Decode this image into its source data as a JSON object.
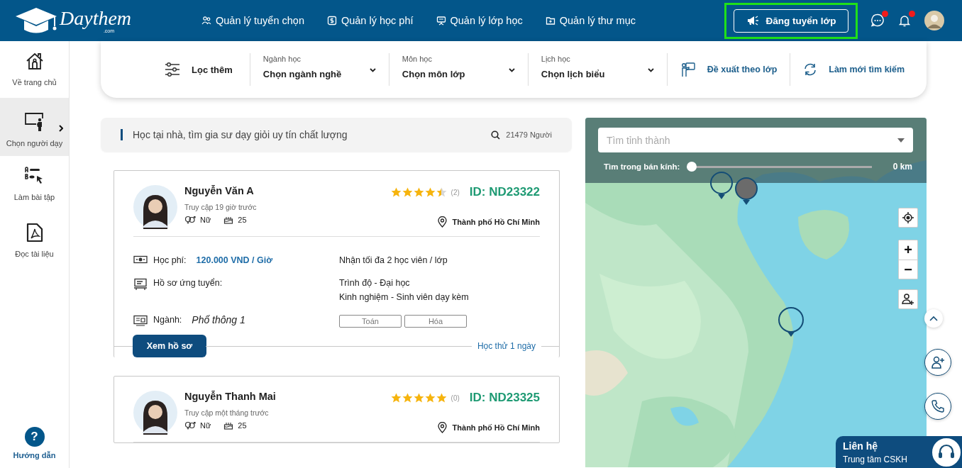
{
  "header": {
    "logo": "Daythem",
    "logo_sub": ".com",
    "nav": [
      "Quản lý tuyển chọn",
      "Quản lý học phí",
      "Quản lý lớp học",
      "Quản lý thư mục"
    ],
    "post_button": "Đăng tuyển lớp",
    "chat_unread": true,
    "bell_unread": true
  },
  "sidebar": {
    "items": [
      {
        "label": "Về trang chủ",
        "selected": false
      },
      {
        "label": "Chọn người dạy",
        "selected": true
      },
      {
        "label": "Làm bài tập",
        "selected": false
      },
      {
        "label": "Đọc tài liệu",
        "selected": false
      }
    ],
    "help": {
      "symbol": "?",
      "label": "Hướng dẫn"
    }
  },
  "filter_bar": {
    "filter_button": "Lọc thêm",
    "selects": [
      {
        "label": "Ngành học",
        "value": "Chọn ngành nghề"
      },
      {
        "label": "Môn học",
        "value": "Chọn môn lớp"
      },
      {
        "label": "Lịch học",
        "value": "Chọn lịch biểu"
      }
    ],
    "actions": [
      "Đề xuất theo lớp",
      "Làm mới tìm kiếm"
    ]
  },
  "search_banner": {
    "text": "Học tại nhà, tìm gia sư dạy giỏi uy tín chất lượng",
    "count": "21479 Người"
  },
  "tutors": [
    {
      "name": "Nguyễn Văn A",
      "last_access": "Truy cập 19 giờ trước",
      "gender": "Nữ",
      "age": "25",
      "stars": 4.5,
      "reviews": "(2)",
      "id": "ID: ND23322",
      "city": "Thành phố Hồ Chí Minh",
      "details": {
        "fee_label": "Học phí:",
        "fee": "120.000 VND / Giờ",
        "capacity": "Nhận tối đa 2 học viên / lớp",
        "profile_label": "Hồ sơ ứng tuyển:",
        "profile_lines": [
          "Trình độ - Đại học",
          "Kinh nghiệm - Sinh viên dạy kèm"
        ],
        "major_label": "Ngành:",
        "major": "Phổ thông 1",
        "subjects": [
          "Toán",
          "Hóa"
        ],
        "view_button": "Xem hồ sơ",
        "trial": "Học thử 1 ngày"
      }
    },
    {
      "name": "Nguyễn Thanh Mai",
      "last_access": "Truy cập một tháng trước",
      "gender": "Nữ",
      "age": "25",
      "stars": 5,
      "reviews": "(0)",
      "id": "ID: ND23325",
      "city": "Thành phố Hồ Chí Minh"
    }
  ],
  "map": {
    "search_placeholder": "Tìm tỉnh thành",
    "radius_label": "Tìm trong bán kính:",
    "radius": {
      "level": 0
    },
    "radius_reading": "0 km",
    "zoom_in": "+",
    "zoom_out": "−"
  },
  "contact": {
    "title": "Liên hệ",
    "subtitle": "Trung tâm CSKH"
  }
}
